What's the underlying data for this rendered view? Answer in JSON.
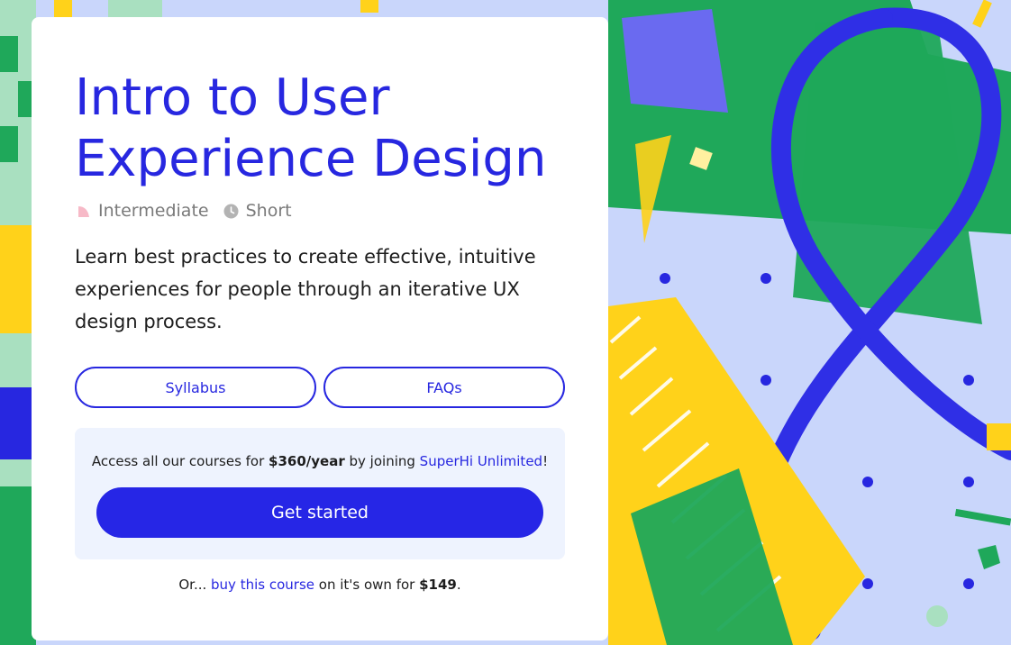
{
  "course": {
    "title": "Intro to User Experience Design",
    "level": "Intermediate",
    "length": "Short",
    "description": "Learn best practices to create effective, intuitive experiences for people through an iterative UX design process."
  },
  "buttons": {
    "syllabus": "Syllabus",
    "faqs": "FAQs"
  },
  "promo": {
    "prefix": "Access all our courses for ",
    "price": "$360/year",
    "middle": " by joining ",
    "link": "SuperHi Unlimited",
    "suffix": "!",
    "cta": "Get started"
  },
  "alt_offer": {
    "prefix": "Or... ",
    "link": "buy this course",
    "middle": " on it's own for ",
    "price": "$149",
    "suffix": "."
  },
  "icons": {
    "level": "difficulty-quarter-icon",
    "length": "clock-icon"
  },
  "colors": {
    "brand_blue": "#2727e0",
    "green": "#1fa85a",
    "yellow": "#ffd21a",
    "light_lavender": "#c9d6fb",
    "promo_bg": "#eef3fe"
  }
}
